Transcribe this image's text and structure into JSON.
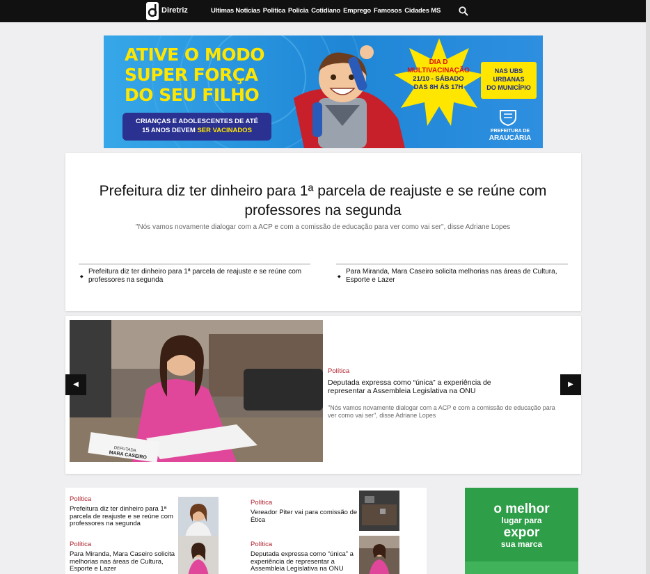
{
  "site": {
    "name": "Diretriz"
  },
  "nav": [
    {
      "label": "Ultimas Noticias"
    },
    {
      "label": "Politica"
    },
    {
      "label": "Policia"
    },
    {
      "label": "Cotidiano"
    },
    {
      "label": "Emprego"
    },
    {
      "label": "Famosos"
    },
    {
      "label": "Cidades MS"
    }
  ],
  "search_icon": "search-icon",
  "banner": {
    "headline_line1": "ATIVE O MODO",
    "headline_line2": "SUPER FORÇA",
    "headline_line3": "DO SEU FILHO",
    "pill_line1": "CRIANÇAS E ADOLESCENTES DE ATÉ",
    "pill_line2_a": "15 ANOS DEVEM ",
    "pill_line2_b": "SER VACINADOS",
    "star_line1": "DIA D",
    "star_line2": "MULTIVACINAÇÃO",
    "star_line3": "21/10 - SÁBADO",
    "star_line4": "DAS 8H ÀS 17H",
    "ubs_line1": "NAS UBS",
    "ubs_line2": "URBANAS",
    "ubs_line3": "DO MUNICÍPIO",
    "pref_small": "PREFEITURA DE",
    "pref_big": "ARAUCÁRIA",
    "colors": {
      "sky": "#2e8fe0",
      "yellow": "#ffe600",
      "navy": "#2a3190"
    }
  },
  "headline": {
    "title": "Prefeitura diz ter dinheiro para 1ª parcela de reajuste e se reúne com professores na segunda",
    "subtitle": "\"Nós vamos novamente dialogar com a ACP e com a comissão de educação para ver como vai ser\", disse Adriane Lopes",
    "related": [
      {
        "title": "Prefeitura diz ter dinheiro para 1ª parcela de reajuste e se reúne com professores na segunda"
      },
      {
        "title": "Para Miranda, Mara Caseiro solicita melhorias nas áreas de Cultura, Esporte e Lazer"
      }
    ]
  },
  "slider": {
    "category": "Política",
    "title": "Deputada expressa como “única” a experiência de representar a Assembleia Legislativa na ONU",
    "subtitle": "\"Nós vamos novamente dialogar com a ACP e com a comissão de educação para ver como vai ser\", disse Adriane Lopes",
    "placard_line1": "DEPUTADA",
    "placard_line2": "MARA CASEIRO",
    "prev_icon": "chevron-left-icon",
    "next_icon": "chevron-right-icon"
  },
  "news": [
    {
      "category": "Política",
      "title": "Prefeitura diz ter dinheiro para 1ª parcela de reajuste e se reúne com professores na segunda"
    },
    {
      "category": "Política",
      "title": "Vereador Piter vai para comissão de Ética"
    },
    {
      "category": "Política",
      "title": "Para Miranda, Mara Caseiro solicita melhorias nas áreas de Cultura, Esporte e Lazer"
    },
    {
      "category": "Política",
      "title": "Deputada expressa como “única” a experiência de representar a Assembleia Legislativa na ONU"
    }
  ],
  "side_ad": {
    "line1": "o melhor",
    "line2": "lugar para",
    "line3": "expor",
    "line4": "sua marca",
    "color": "#2e9e48"
  }
}
